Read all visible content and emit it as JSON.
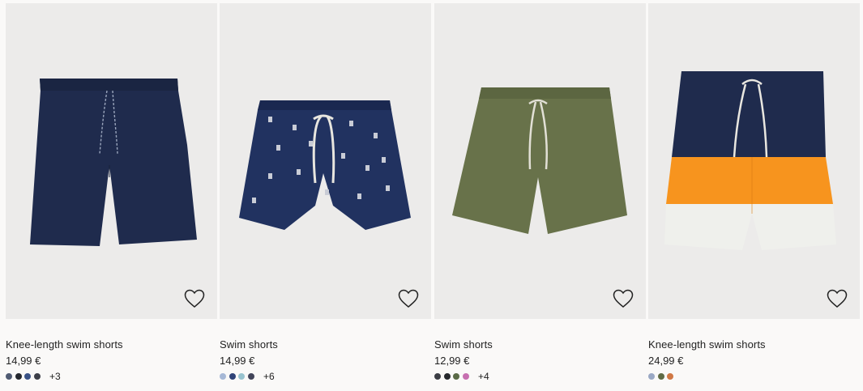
{
  "products": [
    {
      "name": "Knee-length swim shorts",
      "price": "14,99 €",
      "swatches": [
        "#4f5a72",
        "#24272e",
        "#3a5286",
        "#3d3f48"
      ],
      "more": "+3",
      "shorts_color": "#1f2b4d",
      "icon": "heart-outline-icon"
    },
    {
      "name": "Swim shorts",
      "price": "14,99 €",
      "swatches": [
        "#a6b8d6",
        "#2f4378",
        "#98c3cf",
        "#414459"
      ],
      "more": "+6",
      "shorts_color": "#213260",
      "icon": "heart-outline-icon"
    },
    {
      "name": "Swim shorts",
      "price": "12,99 €",
      "swatches": [
        "#3b3d44",
        "#26282c",
        "#5a6a46",
        "#c76fb0"
      ],
      "more": "+4",
      "shorts_color": "#68724a",
      "icon": "heart-outline-icon"
    },
    {
      "name": "Knee-length swim shorts",
      "price": "24,99 €",
      "swatches": [
        "#9aa8c4",
        "#5f6b45",
        "#d07845"
      ],
      "more": "",
      "shorts_color": "#1f2b4d",
      "icon": "heart-outline-icon"
    }
  ]
}
